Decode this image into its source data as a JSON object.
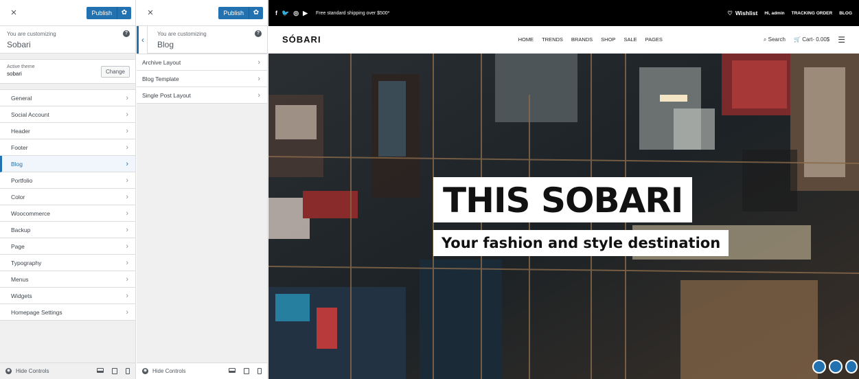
{
  "panel1": {
    "close_label": "×",
    "publish_label": "Publish",
    "customizing_label": "You are customizing",
    "site_name": "Sobari",
    "active_theme_label": "Active theme",
    "theme_name": "sobari",
    "change_label": "Change",
    "items": [
      {
        "label": "General"
      },
      {
        "label": "Social Account"
      },
      {
        "label": "Header"
      },
      {
        "label": "Footer"
      },
      {
        "label": "Blog"
      },
      {
        "label": "Portfolio"
      },
      {
        "label": "Color"
      },
      {
        "label": "Woocommerce"
      },
      {
        "label": "Backup"
      },
      {
        "label": "Page"
      },
      {
        "label": "Typography"
      },
      {
        "label": "Menus"
      },
      {
        "label": "Widgets"
      },
      {
        "label": "Homepage Settings"
      }
    ],
    "active_index": 4,
    "hide_controls_label": "Hide Controls"
  },
  "panel2": {
    "close_label": "×",
    "publish_label": "Publish",
    "customizing_label": "You are customizing",
    "section_name": "Blog",
    "items": [
      {
        "label": "Archive Layout"
      },
      {
        "label": "Blog Template"
      },
      {
        "label": "Single Post Layout"
      }
    ],
    "hide_controls_label": "Hide Controls"
  },
  "preview": {
    "topbar": {
      "shipping": "Free standard shipping over $500*",
      "wishlist": "Wishlist",
      "greeting": "Hi, admin",
      "tracking": "TRACKING ORDER",
      "blog": "BLOG"
    },
    "logo": "SÓBARI",
    "nav": [
      "HOME",
      "TRENDS",
      "BRANDS",
      "SHOP",
      "SALE",
      "PAGES"
    ],
    "search": "Search",
    "cart": "Cart- 0.00$",
    "hero_title": "THIS SOBARI",
    "hero_subtitle": "Your fashion and style destination"
  },
  "icons": [
    "close-icon",
    "gear-icon",
    "help-icon",
    "chevron-right-icon",
    "chevron-left-icon",
    "eye-icon",
    "desktop-icon",
    "tablet-icon",
    "mobile-icon",
    "facebook-icon",
    "twitter-icon",
    "instagram-icon",
    "youtube-icon",
    "heart-icon",
    "search-icon",
    "cart-icon",
    "hamburger-icon"
  ],
  "colors": {
    "accent": "#2271b1",
    "topbar": "#000000"
  }
}
